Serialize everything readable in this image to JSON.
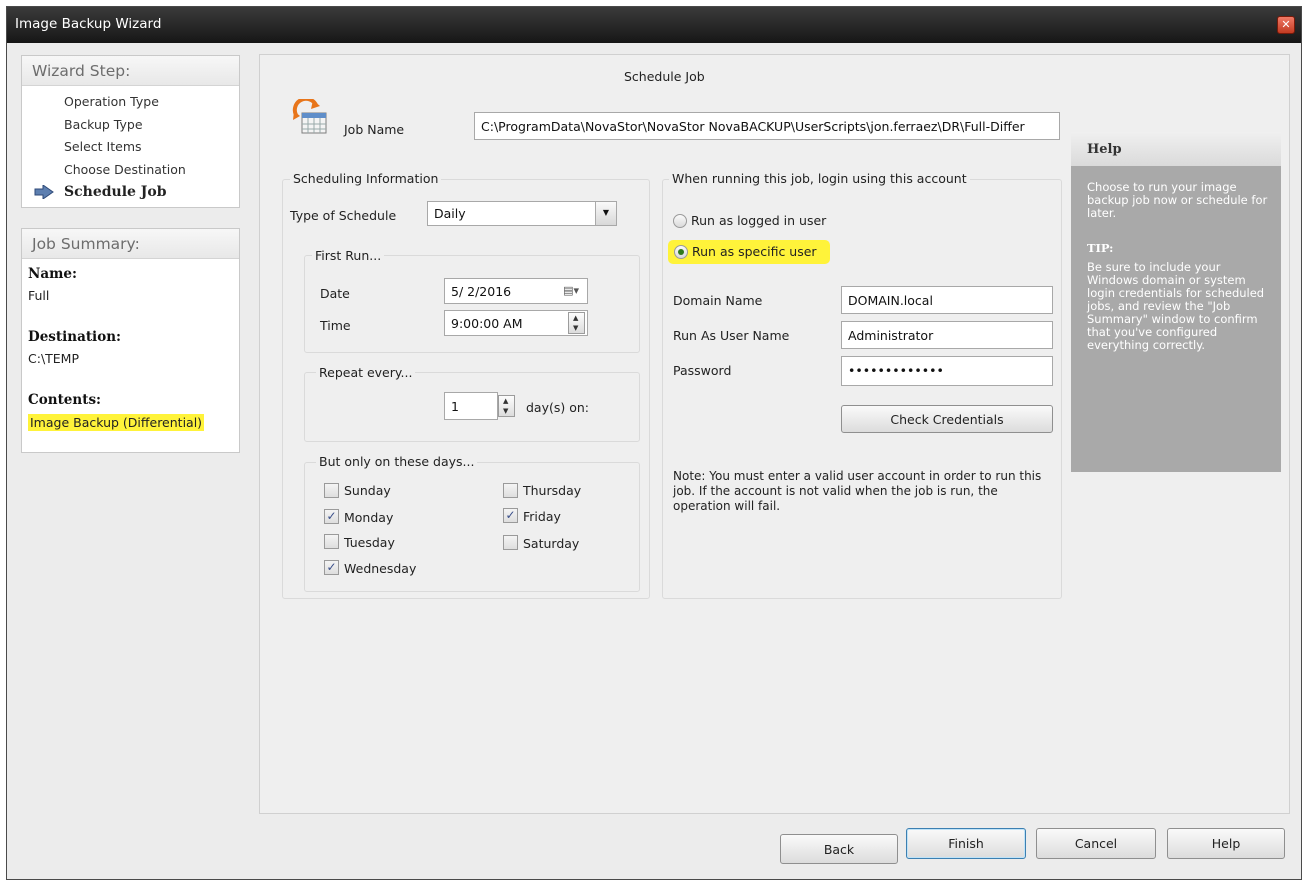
{
  "window": {
    "title": "Image Backup Wizard"
  },
  "wizard": {
    "header": "Wizard Step:",
    "steps": [
      "Operation Type",
      "Backup Type",
      "Select Items",
      "Choose Destination"
    ],
    "current_step": "Schedule Job"
  },
  "summary": {
    "header": "Job Summary:",
    "name_label": "Name:",
    "name_value": "Full",
    "destination_label": "Destination:",
    "destination_value": "C:\\TEMP",
    "contents_label": "Contents:",
    "contents_value": "Image Backup (Differential)"
  },
  "main": {
    "title": "Schedule Job",
    "job_name_label": "Job Name",
    "job_name_value": "C:\\ProgramData\\NovaStor\\NovaStor NovaBACKUP\\UserScripts\\jon.ferraez\\DR\\Full-Differ"
  },
  "scheduling": {
    "group_label": "Scheduling Information",
    "type_label": "Type of Schedule",
    "type_value": "Daily",
    "first_run_label": "First Run...",
    "date_label": "Date",
    "date_value": "5/ 2/2016",
    "time_label": "Time",
    "time_value": "9:00:00 AM",
    "repeat_label": "Repeat every...",
    "repeat_value": "1",
    "repeat_unit": "day(s) on:",
    "days_label": "But only on these days...",
    "days": [
      {
        "name": "Sunday",
        "checked": false
      },
      {
        "name": "Monday",
        "checked": true
      },
      {
        "name": "Tuesday",
        "checked": false
      },
      {
        "name": "Wednesday",
        "checked": true
      },
      {
        "name": "Thursday",
        "checked": false
      },
      {
        "name": "Friday",
        "checked": true
      },
      {
        "name": "Saturday",
        "checked": false
      }
    ]
  },
  "account": {
    "group_label": "When running this job, login using this account",
    "radio_logged_in": "Run as logged in user",
    "radio_specific": "Run as specific user",
    "selected": "specific",
    "domain_label": "Domain Name",
    "domain_value": "DOMAIN.local",
    "user_label": "Run As User Name",
    "user_value": "Administrator",
    "password_label": "Password",
    "password_value": "•••••••••••••",
    "check_button": "Check Credentials",
    "note": "Note: You must enter a valid user account in order to run this job. If the account is not valid when the job is run, the operation will fail."
  },
  "help": {
    "title": "Help",
    "text": "Choose to run your image backup job now or schedule for later.",
    "tip_label": "TIP:",
    "tip_text": "Be sure to include your Windows domain or system login credentials for scheduled jobs, and review the \"Job Summary\" window to confirm that you've configured everything correctly."
  },
  "buttons": {
    "back": "Back",
    "finish": "Finish",
    "cancel": "Cancel",
    "help": "Help"
  },
  "colors": {
    "highlight": "#fff33a",
    "help_bg": "#a9a9a9",
    "titlebar": "#1f1f1f"
  }
}
